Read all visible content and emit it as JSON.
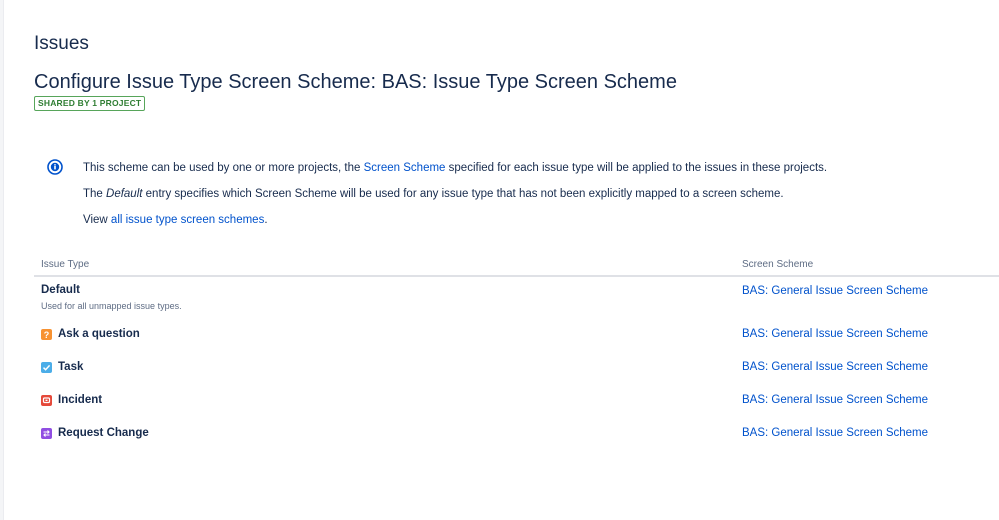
{
  "header": {
    "section_title": "Issues",
    "page_title": "Configure Issue Type Screen Scheme: BAS: Issue Type Screen Scheme",
    "shared_badge": "SHARED BY 1 PROJECT"
  },
  "info": {
    "line1_before": "This scheme can be used by one or more projects, the ",
    "line1_link": "Screen Scheme",
    "line1_after": " specified for each issue type will be applied to the issues in these projects.",
    "line2_before": "The ",
    "line2_em": "Default",
    "line2_after": " entry specifies which Screen Scheme will be used for any issue type that has not been explicitly mapped to a screen scheme.",
    "line3_before": "View ",
    "line3_link": "all issue type screen schemes",
    "line3_after": "."
  },
  "table": {
    "columns": [
      "Issue Type",
      "Screen Scheme"
    ],
    "rows": [
      {
        "name": "Default",
        "description": "Used for all unmapped issue types.",
        "scheme": "BAS: General Issue Screen Scheme"
      },
      {
        "name": "Ask a question",
        "icon": "question-icon",
        "scheme": "BAS: General Issue Screen Scheme"
      },
      {
        "name": "Task",
        "icon": "task-checkbox-icon",
        "scheme": "BAS: General Issue Screen Scheme"
      },
      {
        "name": "Incident",
        "icon": "incident-icon",
        "scheme": "BAS: General Issue Screen Scheme"
      },
      {
        "name": "Request Change",
        "icon": "request-change-icon",
        "scheme": "BAS: General Issue Screen Scheme"
      }
    ]
  },
  "colors": {
    "link": "#0052cc",
    "text": "#172b4d",
    "badge_green": "#2e7d32",
    "info_blue": "#0052cc",
    "question_orange": "#f79232",
    "task_blue": "#4bade8",
    "incident_red": "#e5493a",
    "change_purple": "#904ee2"
  }
}
